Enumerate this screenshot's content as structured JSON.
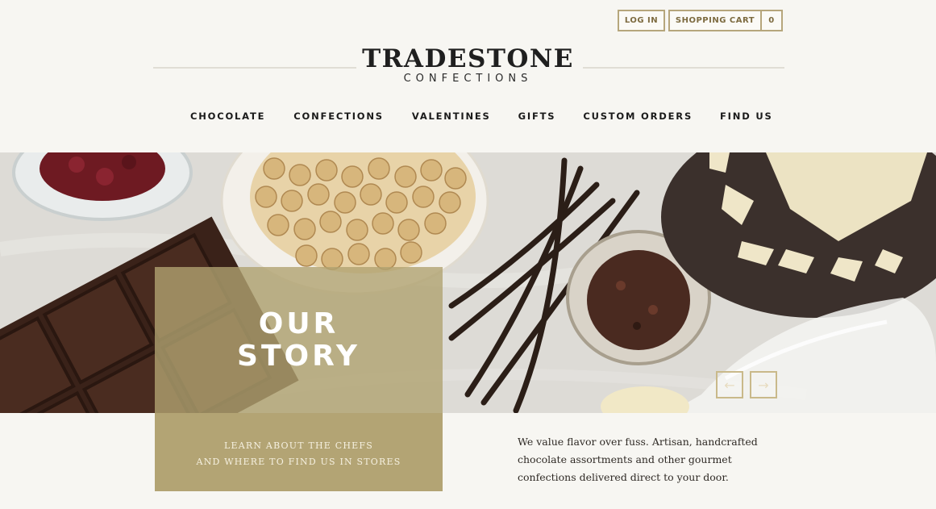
{
  "header": {
    "login_label": "LOG IN",
    "cart_label": "SHOPPING CART",
    "cart_count": "0"
  },
  "logo": {
    "name": "TRADESTONE",
    "subtitle": "CONFECTIONS"
  },
  "nav": {
    "items": [
      {
        "label": "CHOCOLATE"
      },
      {
        "label": "CONFECTIONS"
      },
      {
        "label": "VALENTINES"
      },
      {
        "label": "GIFTS"
      },
      {
        "label": "CUSTOM ORDERS"
      },
      {
        "label": "FIND US"
      }
    ]
  },
  "hero": {
    "title_line1": "OUR",
    "title_line2": "STORY",
    "link_line1": "LEARN ABOUT THE CHEFS",
    "link_line2": "AND WHERE TO FIND US IN STORES",
    "prev_icon": "arrow-left-icon",
    "next_icon": "arrow-right-icon"
  },
  "tagline": {
    "line1": "We value flavor over fuss. Artisan, handcrafted",
    "line2": "chocolate assortments and other gourmet",
    "line3": "confections delivered direct to your door."
  },
  "colors": {
    "accent_gold": "#b3a474",
    "text_dark": "#1a1a1a",
    "background": "#f7f6f2"
  }
}
